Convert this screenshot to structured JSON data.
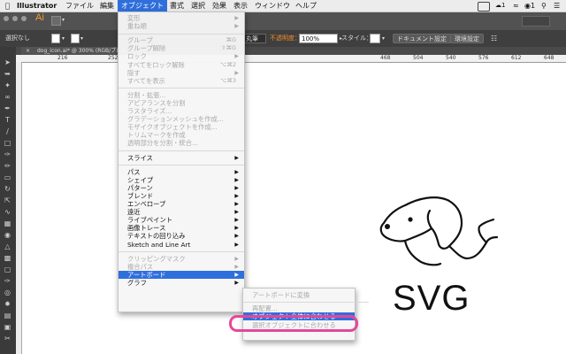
{
  "menubar": {
    "app": "Illustrator",
    "items": [
      "ファイル",
      "編集",
      "オブジェクト",
      "書式",
      "選択",
      "効果",
      "表示",
      "ウィンドウ",
      "ヘルプ"
    ],
    "active_index": 2,
    "battery_count": "1",
    "notify_count": "1"
  },
  "appbar": {
    "logo": "Ai"
  },
  "controlbar": {
    "selection": "選択なし",
    "stroke_style": "丸筆",
    "opacity_label": "不透明度：",
    "opacity_value": "100%",
    "style_label": "スタイル：",
    "doc_settings": "ドキュメント設定",
    "preferences": "環境設定"
  },
  "document": {
    "tab_title": "dog_icon.ai* @ 300% (RGB/プレビ",
    "ruler_marks": [
      "216",
      "252",
      "468",
      "504",
      "540",
      "576",
      "612",
      "648"
    ]
  },
  "menu": {
    "items": [
      {
        "label": "変形",
        "type": "sub",
        "disabled": true
      },
      {
        "label": "重ね順",
        "type": "sub",
        "disabled": true
      },
      {
        "type": "sep"
      },
      {
        "label": "グループ",
        "shortcut": "⌘G",
        "disabled": true
      },
      {
        "label": "グループ解除",
        "shortcut": "⇧⌘G",
        "disabled": true
      },
      {
        "label": "ロック",
        "type": "sub",
        "disabled": true
      },
      {
        "label": "すべてをロック解除",
        "shortcut": "⌥⌘2",
        "disabled": true
      },
      {
        "label": "隠す",
        "type": "sub",
        "disabled": true
      },
      {
        "label": "すべてを表示",
        "shortcut": "⌥⌘3",
        "disabled": true
      },
      {
        "type": "sep"
      },
      {
        "label": "分割・拡張...",
        "disabled": true
      },
      {
        "label": "アピアランスを分割",
        "disabled": true
      },
      {
        "label": "ラスタライズ...",
        "disabled": true
      },
      {
        "label": "グラデーションメッシュを作成...",
        "disabled": true
      },
      {
        "label": "モザイクオブジェクトを作成...",
        "disabled": true
      },
      {
        "label": "トリムマークを作成",
        "disabled": true
      },
      {
        "label": "透明部分を分割・統合...",
        "disabled": true
      },
      {
        "type": "sep"
      },
      {
        "label": "スライス",
        "type": "sub"
      },
      {
        "type": "sep"
      },
      {
        "label": "パス",
        "type": "sub"
      },
      {
        "label": "シェイプ",
        "type": "sub"
      },
      {
        "label": "パターン",
        "type": "sub"
      },
      {
        "label": "ブレンド",
        "type": "sub"
      },
      {
        "label": "エンベロープ",
        "type": "sub"
      },
      {
        "label": "遠近",
        "type": "sub"
      },
      {
        "label": "ライブペイント",
        "type": "sub"
      },
      {
        "label": "画像トレース",
        "type": "sub"
      },
      {
        "label": "テキストの回り込み",
        "type": "sub"
      },
      {
        "label": "Sketch and Line Art",
        "type": "sub"
      },
      {
        "type": "sep"
      },
      {
        "label": "クリッピングマスク",
        "type": "sub",
        "disabled": true
      },
      {
        "label": "複合パス",
        "type": "sub",
        "disabled": true
      },
      {
        "label": "アートボード",
        "type": "sub",
        "highlighted": true
      },
      {
        "label": "グラフ",
        "type": "sub"
      }
    ]
  },
  "submenu": {
    "items": [
      {
        "label": "アートボードに変換",
        "disabled": true
      },
      {
        "type": "sep"
      },
      {
        "label": "再配置...",
        "disabled": true
      },
      {
        "label": "オブジェクト全体に合わせる",
        "highlighted": true
      },
      {
        "label": "選択オブジェクトに合わせる",
        "disabled": true
      }
    ]
  },
  "artwork": {
    "caption": "SVG"
  },
  "colors": {
    "accent": "#2f6fdc",
    "ring": "#e4479a",
    "toolbar": "#3a3a3a"
  }
}
